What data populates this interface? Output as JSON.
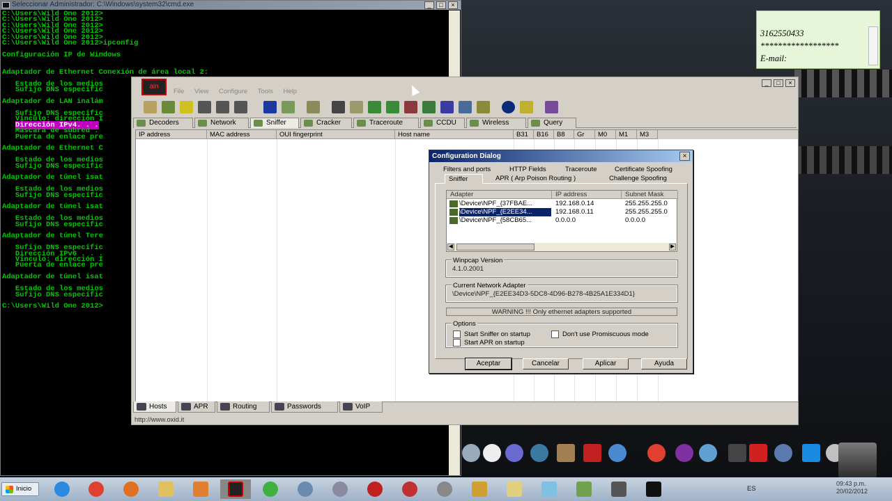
{
  "cmd": {
    "title": "Seleccionar Administrador: C:\\Windows\\system32\\cmd.exe",
    "lines": [
      "C:\\Users\\Wild One 2012>",
      "C:\\Users\\Wild One 2012>",
      "C:\\Users\\Wild One 2012>",
      "C:\\Users\\Wild One 2012>",
      "C:\\Users\\Wild One 2012>",
      "C:\\Users\\Wild One 2012>ipconfig",
      "",
      "Configuración IP de Windows",
      "",
      "",
      "Adaptador de Ethernet Conexión de área local 2:",
      "",
      "   Estado de los medios",
      "   Sufijo DNS específic",
      "",
      "Adaptador de LAN inalám",
      "",
      "   Sufijo DNS específic",
      "   Vínculo: dirección I",
      "   Dirección IPv4. . .",
      "   Máscara de subred .",
      "   Puerta de enlace pre",
      "",
      "Adaptador de Ethernet C",
      "",
      "   Estado de los medios",
      "   Sufijo DNS específic",
      "",
      "Adaptador de túnel isat",
      "",
      "   Estado de los medios",
      "   Sufijo DNS específic",
      "",
      "Adaptador de túnel isat",
      "",
      "   Estado de los medios",
      "   Sufijo DNS específic",
      "",
      "Adaptador de túnel Tere",
      "",
      "   Sufijo DNS específic",
      "   Dirección IPv6 . . .",
      "   Vínculo: dirección I",
      "   Puerta de enlace pre",
      "",
      "Adaptador de túnel isat",
      "",
      "   Estado de los medios",
      "   Sufijo DNS específic",
      "",
      "C:\\Users\\Wild One 2012>"
    ]
  },
  "sticky": {
    "line1": "3162550433",
    "line2": "******************",
    "line3": "E-mail:"
  },
  "cain": {
    "menu": [
      "File",
      "View",
      "Configure",
      "Tools",
      "Help"
    ],
    "tabs": [
      "Decoders",
      "Network",
      "Sniffer",
      "Cracker",
      "Traceroute",
      "CCDU",
      "Wireless",
      "Query"
    ],
    "columns": [
      "IP address",
      "MAC address",
      "OUI fingerprint",
      "Host name",
      "B31",
      "B16",
      "B8",
      "Gr",
      "M0",
      "M1",
      "M3"
    ],
    "bottom_tabs": [
      "Hosts",
      "APR",
      "Routing",
      "Passwords",
      "VoIP"
    ],
    "status": "http://www.oxid.it"
  },
  "dialog": {
    "title": "Configuration Dialog",
    "tabs_row1": [
      "Filters and ports",
      "HTTP Fields",
      "Traceroute",
      "Certificate Spoofing"
    ],
    "tabs_row2": [
      "Sniffer",
      "APR ( Arp Poison Routing )",
      "Challenge Spoofing"
    ],
    "list_headers": [
      "Adapter",
      "IP address",
      "Subnet Mask"
    ],
    "adapters": [
      {
        "adapter": "\\Device\\NPF_{37FBAE...",
        "ip": "192.168.0.14",
        "mask": "255.255.255.0"
      },
      {
        "adapter": "\\Device\\NPF_{E2EE34...",
        "ip": "192.168.0.11",
        "mask": "255.255.255.0"
      },
      {
        "adapter": "\\Device\\NPF_{58CB65...",
        "ip": "0.0.0.0",
        "mask": "0.0.0.0"
      }
    ],
    "winpcap_label": "Winpcap Version",
    "winpcap_value": "4.1.0.2001",
    "current_label": "Current Network Adapter",
    "current_value": "\\Device\\NPF_{E2EE34D3-5DC8-4D96-B278-4B25A1E334D1}",
    "warning": "WARNING !!! Only ethernet adapters supported",
    "options_label": "Options",
    "opt_sniffer": "Start Sniffer on startup",
    "opt_promisc": "Don't use Promiscuous mode",
    "opt_apr": "Start APR on startup",
    "buttons": [
      "Aceptar",
      "Cancelar",
      "Aplicar",
      "Ayuda"
    ]
  },
  "taskbar": {
    "start": "Inicio",
    "lang": "ES",
    "time": "09:43 p.m.",
    "date": "20/02/2012"
  }
}
